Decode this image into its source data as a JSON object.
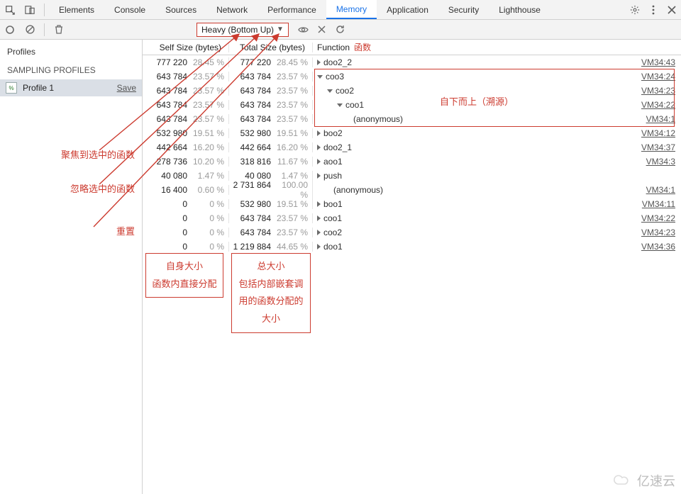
{
  "tabs": [
    "Elements",
    "Console",
    "Sources",
    "Network",
    "Performance",
    "Memory",
    "Application",
    "Security",
    "Lighthouse"
  ],
  "active_tab": "Memory",
  "toolbar": {
    "dropdown": "Heavy (Bottom Up)",
    "icons": {
      "eye": "eye-icon",
      "close": "close-icon",
      "refresh": "refresh-icon"
    }
  },
  "sidebar": {
    "title": "Profiles",
    "section": "SAMPLING PROFILES",
    "profile": "Profile 1",
    "save": "Save"
  },
  "sidebar_annos": {
    "focus": "聚焦到选中的函数",
    "ignore": "忽略选中的函数",
    "reset": "重置"
  },
  "columns": {
    "self": "Self Size (bytes)",
    "total": "Total Size (bytes)",
    "fn": "Function",
    "fn_zh": "函数"
  },
  "rows": [
    {
      "self": "777 220",
      "sp": "28.45 %",
      "total": "777 220",
      "tp": "28.45 %",
      "tri": "closed",
      "ind": 0,
      "fn": "doo2_2",
      "link": "VM34:43"
    },
    {
      "self": "643 784",
      "sp": "23.57 %",
      "total": "643 784",
      "tp": "23.57 %",
      "tri": "open",
      "ind": 0,
      "fn": "coo3",
      "link": "VM34:24",
      "hl": true
    },
    {
      "self": "643 784",
      "sp": "23.57 %",
      "total": "643 784",
      "tp": "23.57 %",
      "tri": "open",
      "ind": 1,
      "fn": "coo2",
      "link": "VM34:23",
      "hl": true
    },
    {
      "self": "643 784",
      "sp": "23.57 %",
      "total": "643 784",
      "tp": "23.57 %",
      "tri": "open",
      "ind": 2,
      "fn": "coo1",
      "link": "VM34:22",
      "hl": true
    },
    {
      "self": "643 784",
      "sp": "23.57 %",
      "total": "643 784",
      "tp": "23.57 %",
      "tri": "none",
      "ind": 3,
      "fn": "(anonymous)",
      "link": "VM34:1",
      "hl": true
    },
    {
      "self": "532 980",
      "sp": "19.51 %",
      "total": "532 980",
      "tp": "19.51 %",
      "tri": "closed",
      "ind": 0,
      "fn": "boo2",
      "link": "VM34:12"
    },
    {
      "self": "442 664",
      "sp": "16.20 %",
      "total": "442 664",
      "tp": "16.20 %",
      "tri": "closed",
      "ind": 0,
      "fn": "doo2_1",
      "link": "VM34:37"
    },
    {
      "self": "278 736",
      "sp": "10.20 %",
      "total": "318 816",
      "tp": "11.67 %",
      "tri": "closed",
      "ind": 0,
      "fn": "aoo1",
      "link": "VM34:3"
    },
    {
      "self": "40 080",
      "sp": "1.47 %",
      "total": "40 080",
      "tp": "1.47 %",
      "tri": "closed",
      "ind": 0,
      "fn": "push",
      "link": ""
    },
    {
      "self": "16 400",
      "sp": "0.60 %",
      "total": "2 731 864",
      "tp": "100.00 %",
      "tri": "none",
      "ind": 1,
      "fn": "(anonymous)",
      "link": "VM34:1"
    },
    {
      "self": "0",
      "sp": "0 %",
      "total": "532 980",
      "tp": "19.51 %",
      "tri": "closed",
      "ind": 0,
      "fn": "boo1",
      "link": "VM34:11"
    },
    {
      "self": "0",
      "sp": "0 %",
      "total": "643 784",
      "tp": "23.57 %",
      "tri": "closed",
      "ind": 0,
      "fn": "coo1",
      "link": "VM34:22"
    },
    {
      "self": "0",
      "sp": "0 %",
      "total": "643 784",
      "tp": "23.57 %",
      "tri": "closed",
      "ind": 0,
      "fn": "coo2",
      "link": "VM34:23"
    },
    {
      "self": "0",
      "sp": "0 %",
      "total": "1 219 884",
      "tp": "44.65 %",
      "tri": "closed",
      "ind": 0,
      "fn": "doo1",
      "link": "VM34:36"
    }
  ],
  "box_self": {
    "l1": "自身大小",
    "l2": "函数内直接分配"
  },
  "box_total": {
    "l1": "总大小",
    "l2": "包括内部嵌套调用的函数分配的大小"
  },
  "inline_ann": "自下而上（溯源）",
  "watermark": "亿速云"
}
